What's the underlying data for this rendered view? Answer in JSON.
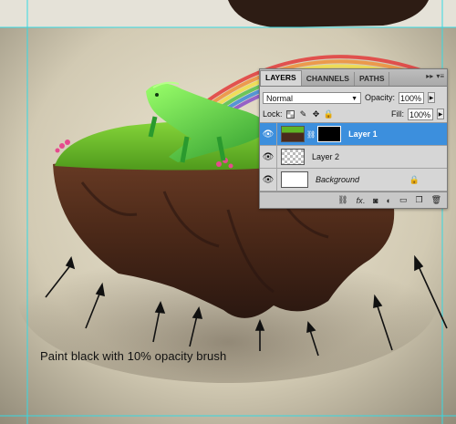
{
  "caption": "Paint black with 10% opacity brush",
  "panel": {
    "tabs": [
      "LAYERS",
      "CHANNELS",
      "PATHS"
    ],
    "blend_mode": "Normal",
    "opacity_label": "Opacity:",
    "opacity_value": "100%",
    "lock_label": "Lock:",
    "fill_label": "Fill:",
    "fill_value": "100%",
    "layers": [
      {
        "name": "Layer 1",
        "selected": true
      },
      {
        "name": "Layer 2",
        "selected": false
      },
      {
        "name": "Background",
        "selected": false
      }
    ]
  },
  "colors": {
    "guide": "#35d9e3",
    "selection": "#3c8fdd",
    "grass": "#5fb526",
    "rock": "#4a2a1c"
  },
  "icons": [
    "eye-icon",
    "lock-icon",
    "link-icon",
    "fx-icon",
    "mask-icon",
    "adjustment-icon",
    "folder-icon",
    "new-layer-icon",
    "trash-icon",
    "arrow-icon"
  ]
}
